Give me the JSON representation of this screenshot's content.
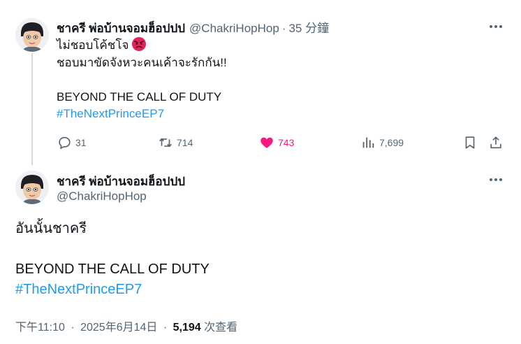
{
  "colors": {
    "accent": "#1d9bf0",
    "like": "#f91880",
    "muted": "#536471",
    "text": "#0f1419",
    "thread_line": "#cfd9de"
  },
  "tweet1": {
    "display_name": "ชาครี พ่อบ้านจอมฮ็อปปป",
    "handle": "@ChakriHopHop",
    "separator": "·",
    "time": "35 分鐘",
    "line1": "ไม่ชอบโค้ชโจ",
    "emoji": "angry-face",
    "line2": "ชอบมาขัดจังหวะคนเค้าจะรักกัน!!",
    "line3": "BEYOND THE CALL OF DUTY",
    "hashtag": "#TheNextPrinceEP7",
    "replies": "31",
    "reposts": "714",
    "likes": "743",
    "views": "7,699"
  },
  "tweet2": {
    "display_name": "ชาครี พ่อบ้านจอมฮ็อปปป",
    "handle": "@ChakriHopHop",
    "line1": "อันนั้นชาครี",
    "line2": "BEYOND THE CALL OF DUTY",
    "hashtag": "#TheNextPrinceEP7",
    "time": "下午11:10",
    "separator": "·",
    "date": "2025年6月14日",
    "views_count": "5,194",
    "views_label": "次查看"
  }
}
